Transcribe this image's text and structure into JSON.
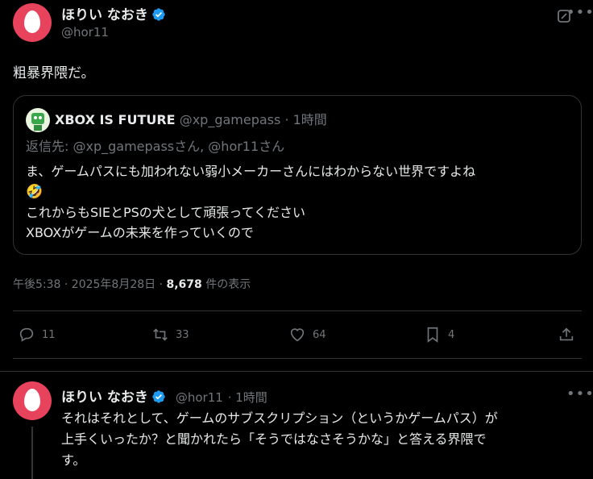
{
  "tweet": {
    "display_name": "ほりい なおき",
    "handle": "@hor11",
    "text": "粗暴界隈だ。",
    "timestamp": "午後5:38 · 2025年8月28日 · ",
    "views_count": "8,678",
    "views_label": "件の表示",
    "actions": {
      "replies": "11",
      "retweets": "33",
      "likes": "64",
      "bookmarks": "4"
    }
  },
  "quoted_tweet": {
    "display_name": "XBOX IS FUTURE",
    "handle": "@xp_gamepass",
    "time": "· 1時間",
    "reply_to": "返信先: @xp_gamepassさん, @hor11さん",
    "line1": "ま、ゲームパスにも加われない弱小メーカーさんにはわからない世界ですよね",
    "emoji": "🤣",
    "line2": "これからもSIEとPSの犬として頑張ってください",
    "line3": "XBOXがゲームの未来を作っていくので"
  },
  "reply": {
    "display_name": "ほりい なおき",
    "handle": "@hor11",
    "time": "· 1時間",
    "line1": "それはそれとして、ゲームのサブスクリプション（というかゲームパス）が",
    "line2": "上手くいったか？と聞かれたら「そうではなさそうかな」と答える界隈で",
    "line3": "す。"
  },
  "colors": {
    "background": "#000000",
    "text": "#e7e9ea",
    "muted": "#71767b",
    "verified": "#1d9bf0",
    "avatar": "#e8435c",
    "border": "#2f3336"
  }
}
